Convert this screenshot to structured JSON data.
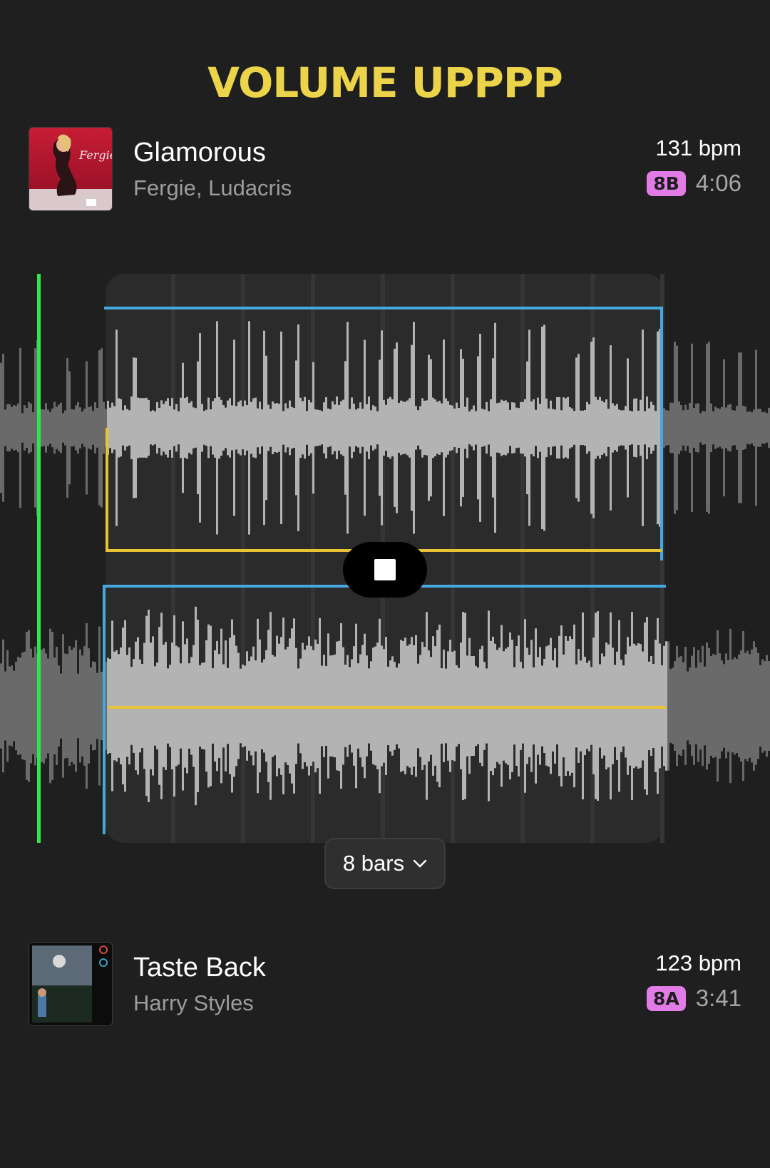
{
  "header": {
    "title": "VOLUME UPPPP"
  },
  "top_track": {
    "title": "Glamorous",
    "artist": "Fergie, Ludacris",
    "bpm": "131 bpm",
    "key": "8B",
    "duration": "4:06",
    "cover_script_text": "Fergie"
  },
  "bottom_track": {
    "title": "Taste Back",
    "artist": "Harry Styles",
    "bpm": "123 bpm",
    "key": "8A",
    "duration": "3:41"
  },
  "loop_control": {
    "label": "8 bars",
    "icon": "chevron-down-icon"
  },
  "playback": {
    "icon": "stop-icon"
  },
  "colors": {
    "background": "#1f1f1f",
    "title": "#ecd44a",
    "key_badge": "#e17ce6",
    "playhead": "#2ee84a",
    "loop_blue": "#43a9de",
    "loop_yellow": "#e9c235",
    "waveform_active": "#b3b3b3",
    "waveform_dim": "#6a6a6a"
  }
}
